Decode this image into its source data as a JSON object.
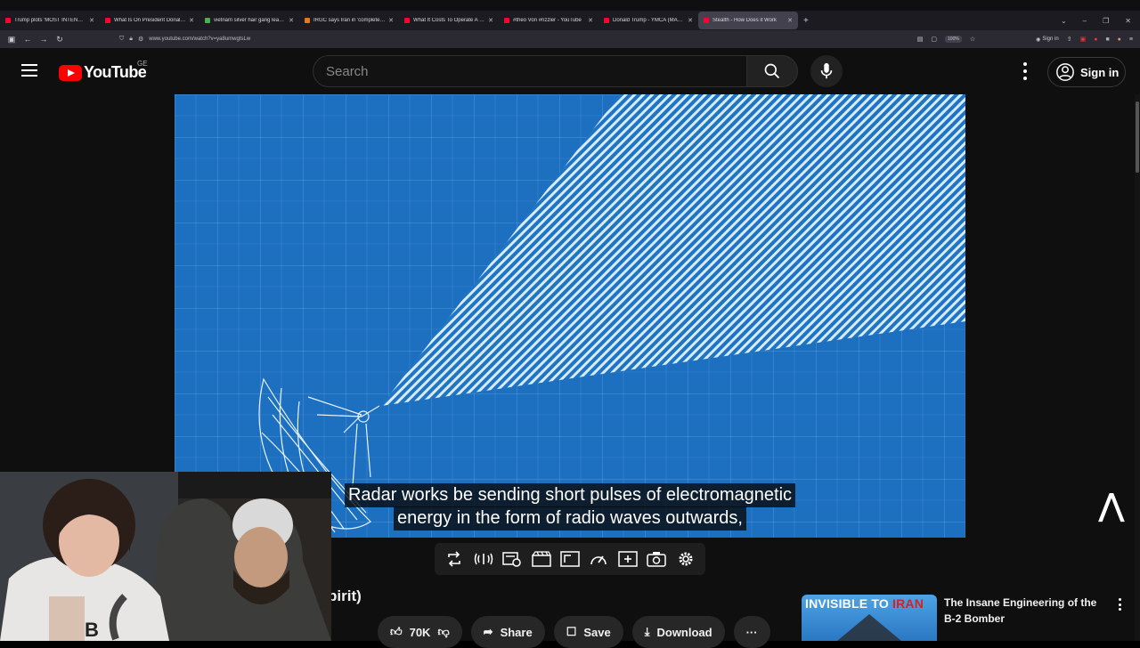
{
  "browser": {
    "tabs": [
      {
        "title": "Trump plots 'MOST INTENSE' a",
        "color": "#ff0033"
      },
      {
        "title": "What Is On President Donald Tr",
        "color": "#ff0033"
      },
      {
        "title": "vietnam silver hair gang leader",
        "color": "#4caf50"
      },
      {
        "title": "IRGC says Iran in 'complete co",
        "color": "#e07a1f"
      },
      {
        "title": "What It Costs To Operate A Uni",
        "color": "#ff0033"
      },
      {
        "title": "#theo Von #rizzler - YouTube",
        "color": "#ff0033"
      },
      {
        "title": "Donald Trump - YMCA (MAGA",
        "color": "#ff0033"
      },
      {
        "title": "Stealth - How Does it Work",
        "color": "#ff0033",
        "active": true
      }
    ],
    "url": "www.youtube.com/watch?v=ya8umwgtsLw",
    "zoom": "100%",
    "sign_in": "Sign in"
  },
  "youtube": {
    "logo_text": "YouTube",
    "region": "GE",
    "search_placeholder": "Search",
    "sign_in": "Sign in"
  },
  "video": {
    "caption_line1": "Radar works be sending short pulses of electromagnetic",
    "caption_line2": "energy in the form of radio waves outwards,",
    "title_partial": "pirit)"
  },
  "actions": {
    "like_count": "70K",
    "share": "Share",
    "save": "Save",
    "download": "Download"
  },
  "related": {
    "thumb_text_white": "INVISIBLE TO ",
    "thumb_text_red": "IRAN",
    "title": "The Insane Engineering of the B-2 Bomber"
  },
  "extension_icons": [
    "repeat-icon",
    "audio-wave-icon",
    "loop-view-icon",
    "cinema-icon",
    "screen-icon",
    "speed-icon",
    "add-icon",
    "screenshot-icon",
    "settings-icon"
  ]
}
